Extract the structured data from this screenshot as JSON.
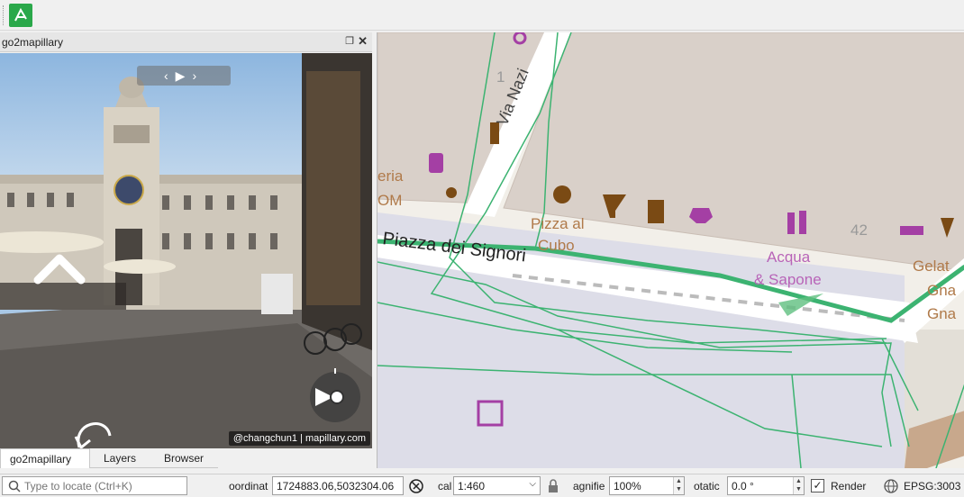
{
  "panel": {
    "title": "go2mapillary",
    "float_glyph": "❐",
    "close_glyph": "✕",
    "nav": {
      "prev": "‹",
      "play": "▶",
      "next": "›"
    },
    "attribution": "@changchun1 | mapillary.com"
  },
  "tabs": [
    {
      "label": "go2mapillary",
      "active": true
    },
    {
      "label": "Layers",
      "active": false
    },
    {
      "label": "Browser",
      "active": false
    }
  ],
  "map": {
    "street_labels": [
      "Via Nazi",
      "Piazza dei Signori"
    ],
    "poi_labels": [
      "eria",
      "OM",
      "Pizza al",
      "Cubo",
      "Acqua",
      "& Sapone",
      "Gelat",
      "Gna",
      "Gna"
    ],
    "numbers": [
      "1",
      "42"
    ]
  },
  "statusbar": {
    "locator_placeholder": "Type to locate (Ctrl+K)",
    "coordinate_label": "oordinat",
    "coordinate_value": "1724883.06,5032304.06",
    "scale_label": "cal",
    "scale_value": "1:460",
    "magnifier_label": "agnifie",
    "magnifier_value": "100%",
    "rotation_label": "otatic",
    "rotation_value": "0.0 °",
    "render_label": "Render",
    "render_checked": true,
    "crs_label": "EPSG:3003"
  },
  "colors": {
    "accent": "#2aa84a",
    "route": "#3cb371",
    "poi": "#a43fa4",
    "food": "#7a4a14"
  }
}
